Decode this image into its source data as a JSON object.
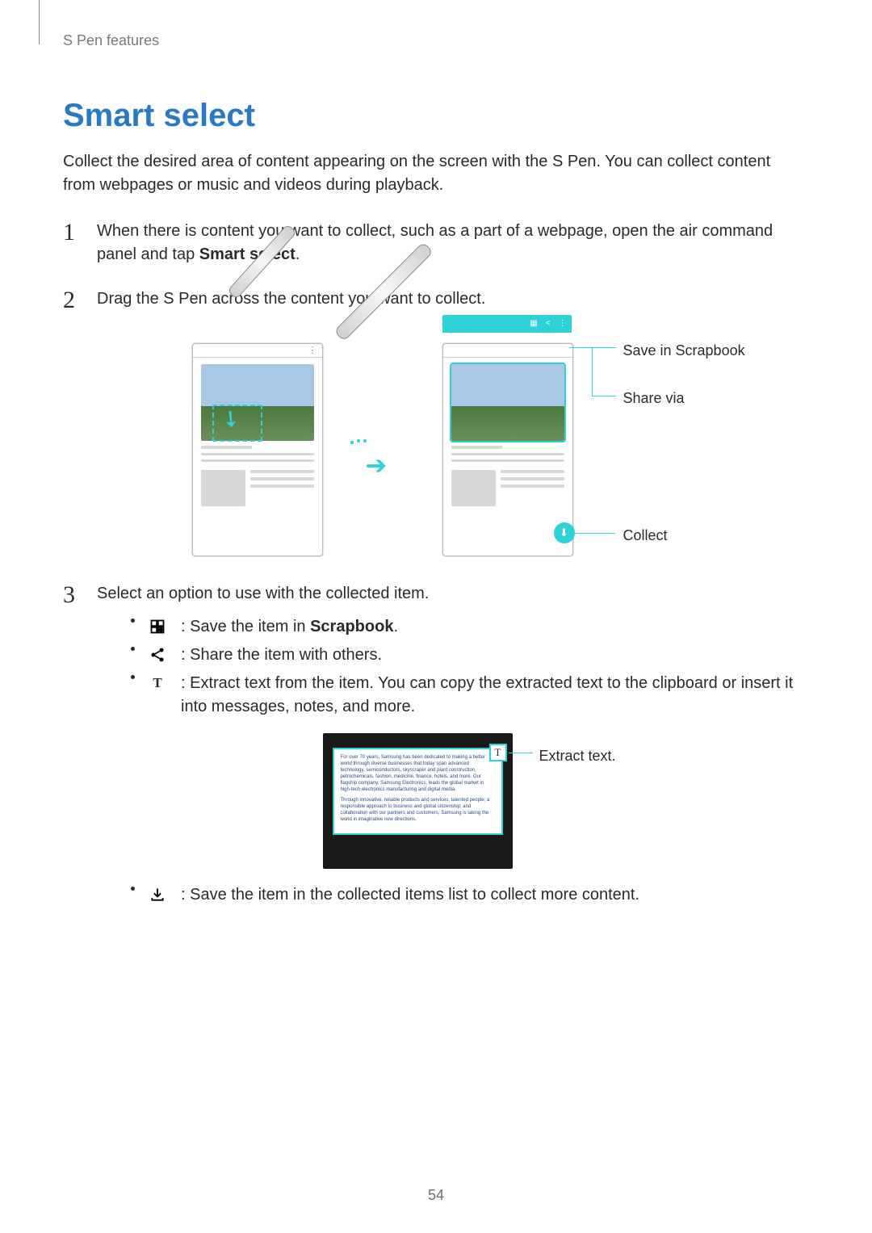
{
  "header": "S Pen features",
  "title": "Smart select",
  "intro": "Collect the desired area of content appearing on the screen with the S Pen. You can collect content from webpages or music and videos during playback.",
  "steps": {
    "s1_a": "When there is content you want to collect, such as a part of a webpage, open the air command panel and tap ",
    "s1_b": "Smart select",
    "s1_c": ".",
    "s2": "Drag the S Pen across the content you want to collect.",
    "s3": "Select an option to use with the collected item."
  },
  "fig1": {
    "save": "Save in Scrapbook",
    "share": "Share via",
    "collect": "Collect"
  },
  "bullets": {
    "scrap_a": " : Save the item in ",
    "scrap_b": "Scrapbook",
    "scrap_c": ".",
    "share": " : Share the item with others.",
    "text": " : Extract text from the item. You can copy the extracted text to the clipboard or insert it into messages, notes, and more.",
    "collect": " : Save the item in the collected items list to collect more content."
  },
  "fig2": {
    "label": "Extract text.",
    "para1": "For over 70 years, Samsung has been dedicated to making a better world through diverse businesses that today span advanced technology, semiconductors, skyscraper and plant construction, petrochemicals, fashion, medicine, finance, hotels, and more. Our flagship company, Samsung Electronics, leads the global market in high-tech electronics manufacturing and digital media.",
    "para2": "Through innovative, reliable products and services; talented people; a responsible approach to business and global citizenship; and collaboration with our partners and customers, Samsung is taking the world in imaginative new directions."
  },
  "page_number": "54"
}
